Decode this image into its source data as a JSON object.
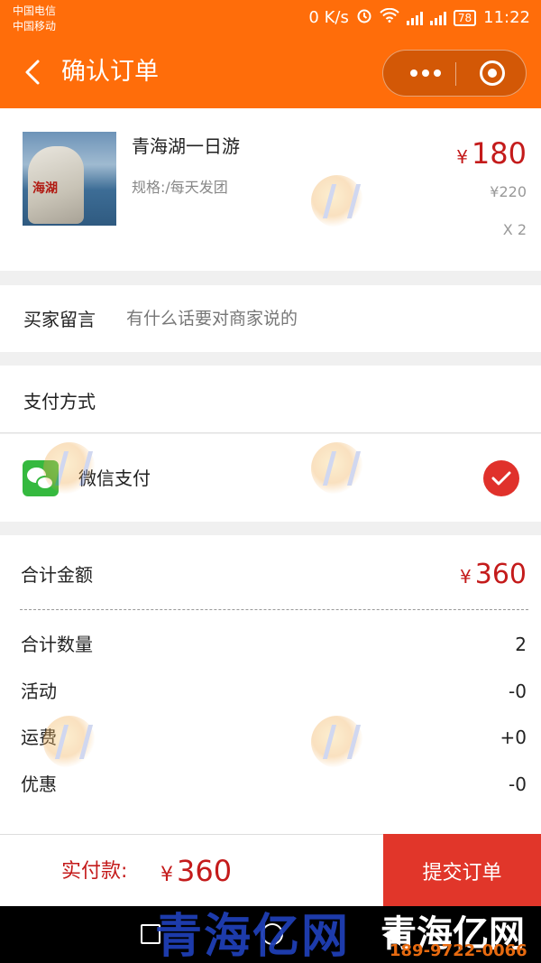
{
  "status_bar": {
    "carrier1": "中国电信",
    "carrier2": "中国移动",
    "speed": "0 K/s",
    "battery": "78",
    "time": "11:22"
  },
  "navbar": {
    "title": "确认订单"
  },
  "product": {
    "name": "青海湖一日游",
    "spec": "规格:/每天发团",
    "price_symbol": "¥",
    "price": "180",
    "original_price": "¥220",
    "quantity": "X 2",
    "thumb_text": "海湖"
  },
  "message": {
    "label": "买家留言",
    "placeholder": "有什么话要对商家说的"
  },
  "payment": {
    "title": "支付方式",
    "option_label": "微信支付"
  },
  "totals": {
    "total_label": "合计金额",
    "total_symbol": "¥",
    "total_value": "360",
    "rows": [
      {
        "label": "合计数量",
        "value": "2"
      },
      {
        "label": "活动",
        "value": "-0"
      },
      {
        "label": "运费",
        "value": "+0"
      },
      {
        "label": "优惠",
        "value": "-0"
      }
    ]
  },
  "footer": {
    "pay_label": "实付款:",
    "pay_symbol": "¥",
    "pay_amount": "360",
    "submit_label": "提交订单"
  },
  "watermark": {
    "brand": "青海亿网",
    "brand2": "青海亿网",
    "phone": "189-9722-0066"
  },
  "colors": {
    "brand_orange": "#ff6d0a",
    "price_red": "#c41b1b",
    "submit_red": "#e1362a",
    "wechat_green": "#35b93f"
  }
}
